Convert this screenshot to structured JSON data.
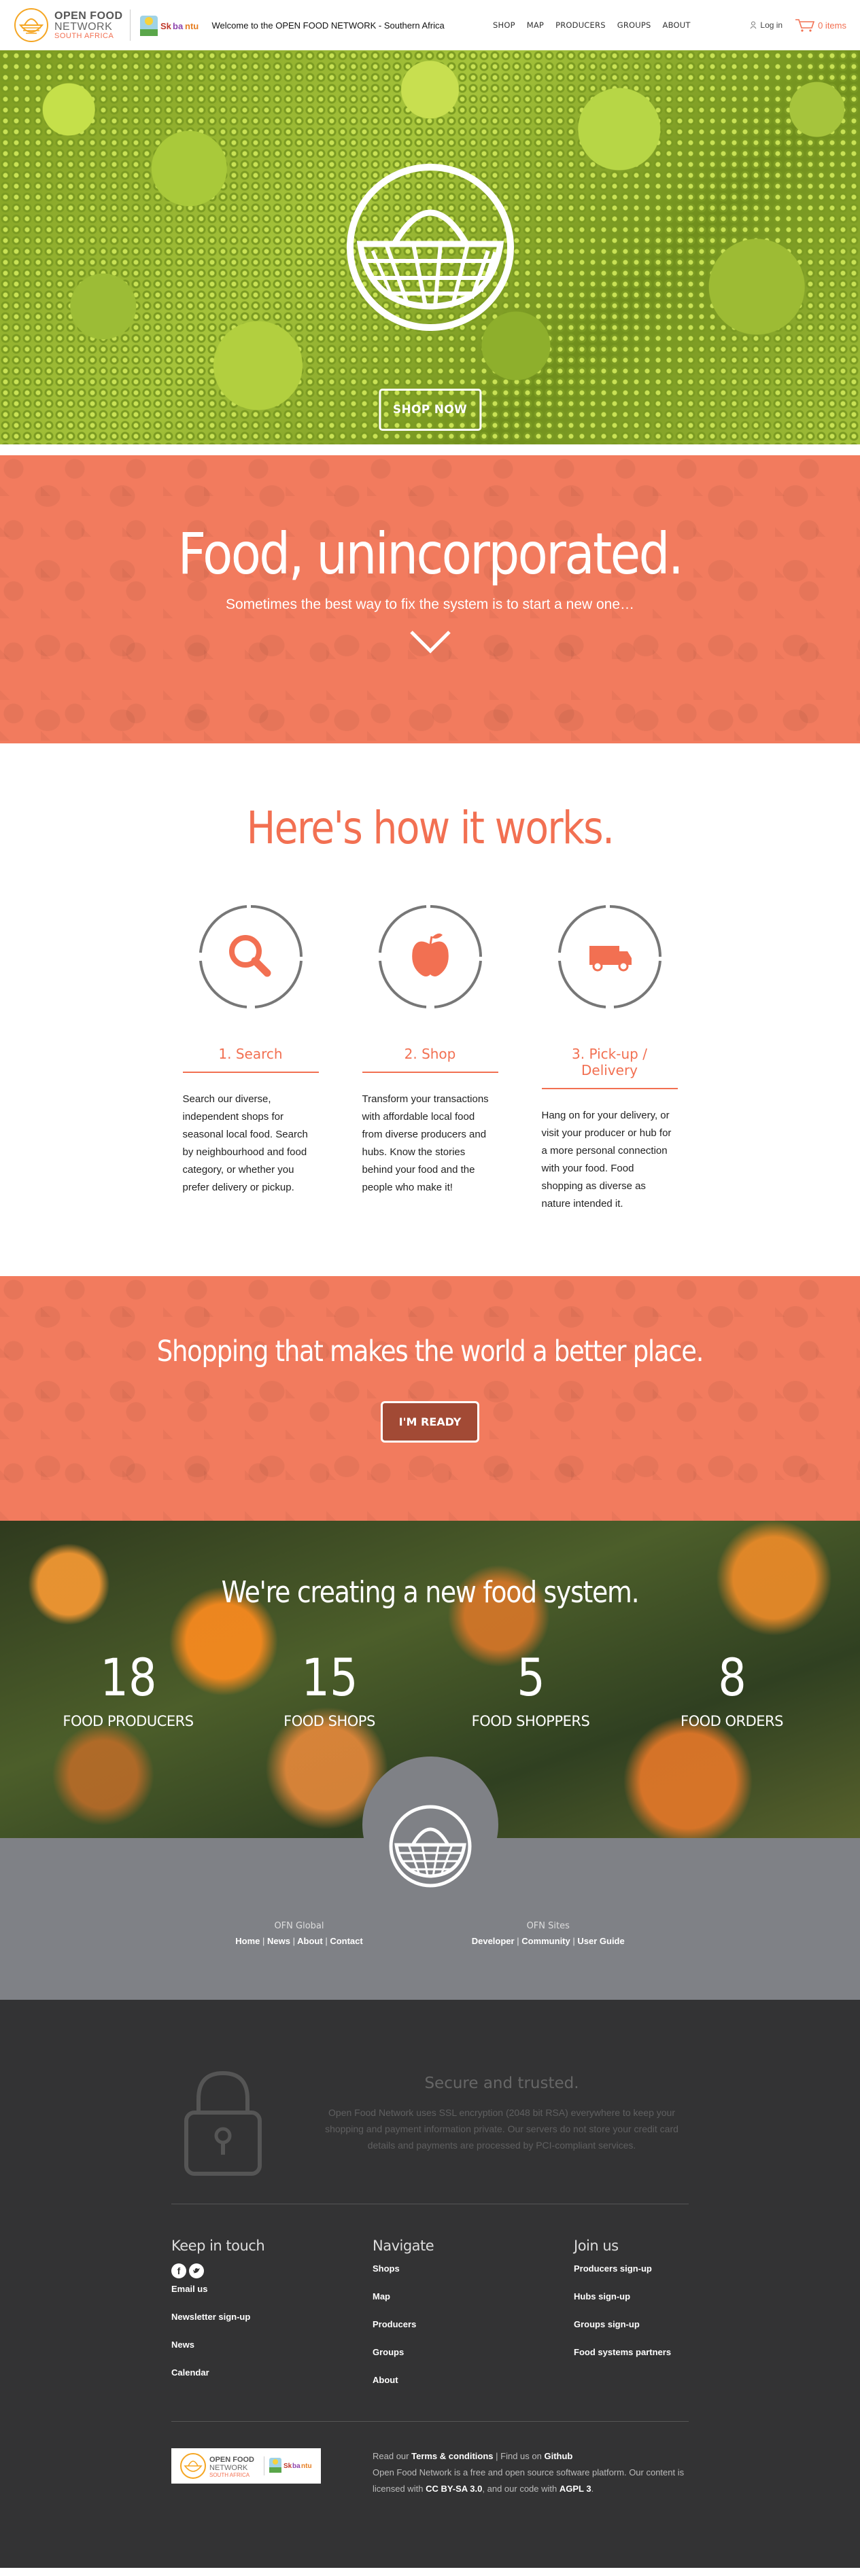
{
  "header": {
    "logo": {
      "line1": "OPEN FOOD",
      "line2": "NETWORK",
      "line3": "SOUTH AFRICA"
    },
    "welcome": "Welcome to the OPEN FOOD NETWORK - Southern Africa",
    "nav": [
      "SHOP",
      "MAP",
      "PRODUCERS",
      "GROUPS",
      "ABOUT"
    ],
    "login": "Log in",
    "cart": "0 items"
  },
  "hero": {
    "button": "SHOP NOW"
  },
  "intro": {
    "title": "Food, unincorporated.",
    "subtitle": "Sometimes the best way to fix the system is to start a new one…"
  },
  "how": {
    "title": "Here's how it works.",
    "steps": [
      {
        "title": "1. Search",
        "text": "Search our diverse, independent shops for seasonal local food. Search by neighbourhood and food category, or whether you prefer delivery or pickup.",
        "icon": "search-icon"
      },
      {
        "title": "2. Shop",
        "text": "Transform your transactions with affordable local food from diverse producers and hubs. Know the stories behind your food and the people who make it!",
        "icon": "apple-icon"
      },
      {
        "title": "3. Pick-up / Delivery",
        "text": "Hang on for your delivery, or visit your producer or hub for a more personal connection with your food. Food shopping as diverse as nature intended it.",
        "icon": "truck-icon"
      }
    ]
  },
  "shopping": {
    "title": "Shopping that makes the world a better place.",
    "button": "I'M READY"
  },
  "stats": {
    "title": "We're creating a new food system.",
    "items": [
      {
        "value": "18",
        "label": "FOOD PRODUCERS"
      },
      {
        "value": "15",
        "label": "FOOD SHOPS"
      },
      {
        "value": "5",
        "label": "FOOD SHOPPERS"
      },
      {
        "value": "8",
        "label": "FOOD ORDERS"
      }
    ]
  },
  "grey_footer": {
    "global_title": "OFN Global",
    "global_links": [
      "Home",
      "News",
      "About",
      "Contact"
    ],
    "sites_title": "OFN Sites",
    "sites_links": [
      "Developer",
      "Community",
      "User Guide"
    ]
  },
  "dark_footer": {
    "secure_title": "Secure and trusted.",
    "secure_body": "Open Food Network uses SSL encryption (2048 bit RSA) everywhere to keep your shopping and payment information private. Our servers do not store your credit card details and payments are processed by PCI-compliant services.",
    "touch": {
      "title": "Keep in touch",
      "links": [
        "Email us",
        "Newsletter sign-up",
        "News",
        "Calendar"
      ]
    },
    "navigate": {
      "title": "Navigate",
      "links": [
        "Shops",
        "Map",
        "Producers",
        "Groups",
        "About"
      ]
    },
    "join": {
      "title": "Join us",
      "links": [
        "Producers sign-up",
        "Hubs sign-up",
        "Groups sign-up",
        "Food systems partners"
      ]
    },
    "legal": {
      "read": "Read our",
      "terms": "Terms & conditions",
      "find": "Find us on",
      "github": "Github",
      "line2a": "Open Food Network is a free and open source software platform. Our content is licensed with",
      "license": "CC BY-SA 3.0",
      "line2b": ", and our code with",
      "agpl": "AGPL 3",
      "dot": "."
    }
  },
  "colors": {
    "accent": "#f27052",
    "band": "#f27b5e",
    "grey": "#7f8186",
    "dark": "#333334"
  }
}
